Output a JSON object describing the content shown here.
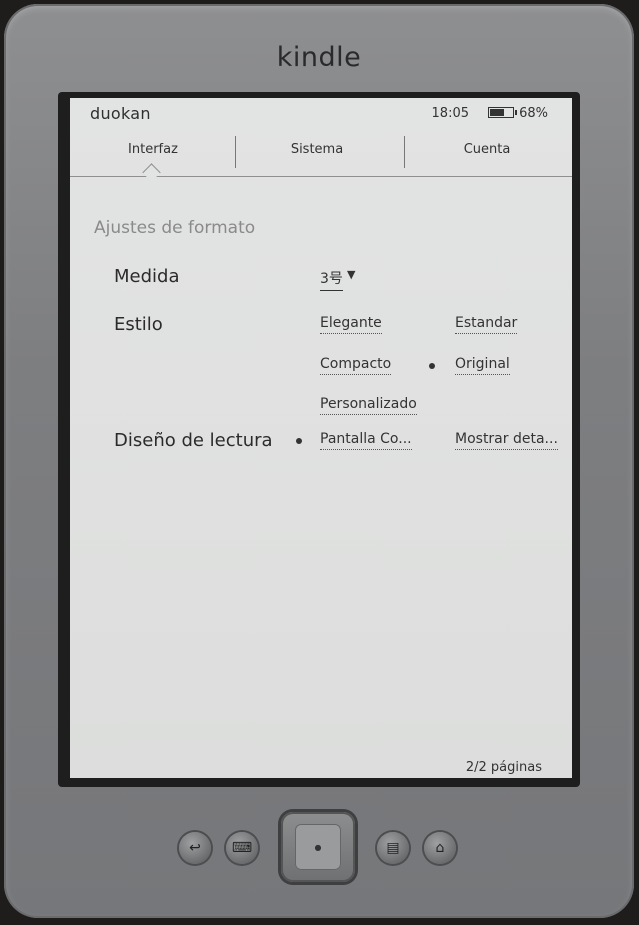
{
  "device": {
    "brand": "kindle"
  },
  "status_bar": {
    "logo": "duokan",
    "time": "18:05",
    "battery_percent": "68%",
    "battery_level": 0.68
  },
  "tabs": [
    {
      "label": "Interfaz",
      "selected": true
    },
    {
      "label": "Sistema",
      "selected": false
    },
    {
      "label": "Cuenta",
      "selected": false
    }
  ],
  "settings": {
    "section_title": "Ajustes de formato",
    "medida": {
      "label": "Medida",
      "value": "3号"
    },
    "estilo": {
      "label": "Estilo",
      "options": [
        "Elegante",
        "Estandar",
        "Compacto",
        "Original",
        "Personalizado"
      ],
      "selected": "Original"
    },
    "diseno": {
      "label": "Diseño de lectura",
      "options": [
        "Pantalla Co...",
        "Mostrar deta..."
      ],
      "selected": "Pantalla Co..."
    }
  },
  "footer": {
    "pages": "2/2 páginas"
  },
  "icons": {
    "back": "back-arrow-icon",
    "keyboard": "keyboard-icon",
    "menu": "menu-icon",
    "home": "home-icon",
    "caret": "caret-down-icon"
  }
}
